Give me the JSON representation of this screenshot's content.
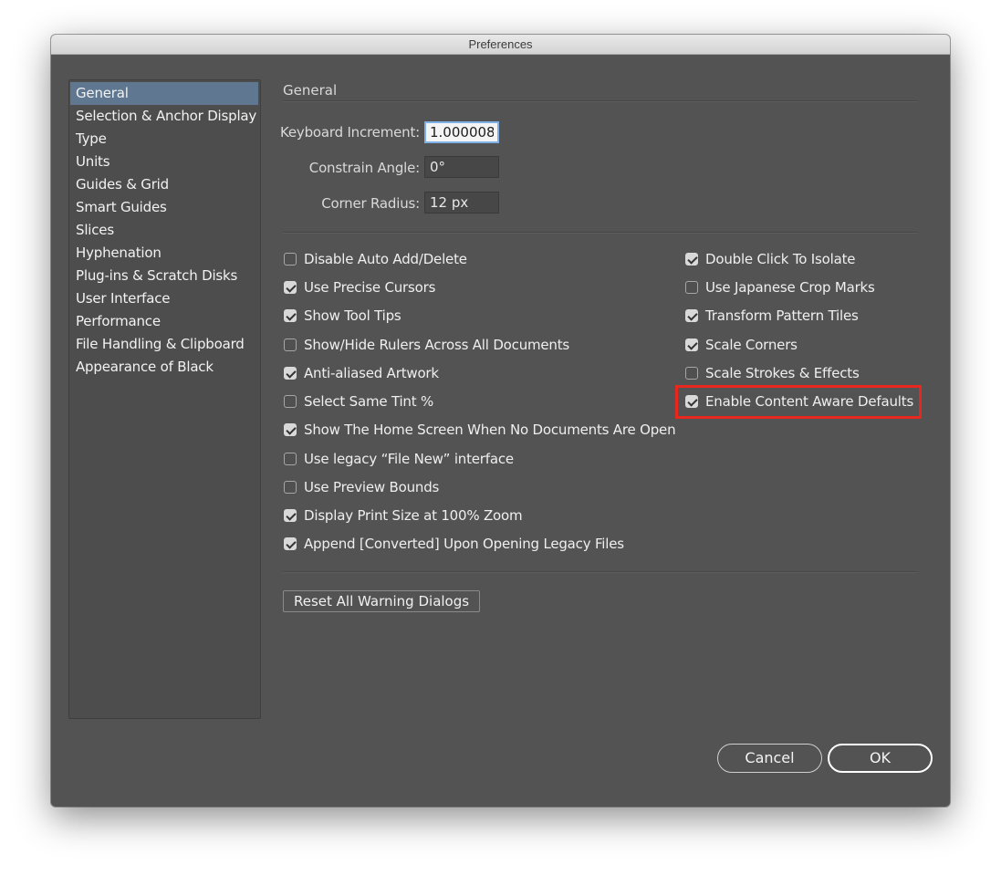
{
  "window": {
    "title": "Preferences"
  },
  "sidebar": {
    "items": [
      {
        "label": "General",
        "selected": true
      },
      {
        "label": "Selection & Anchor Display"
      },
      {
        "label": "Type"
      },
      {
        "label": "Units"
      },
      {
        "label": "Guides & Grid"
      },
      {
        "label": "Smart Guides"
      },
      {
        "label": "Slices"
      },
      {
        "label": "Hyphenation"
      },
      {
        "label": "Plug-ins & Scratch Disks"
      },
      {
        "label": "User Interface"
      },
      {
        "label": "Performance"
      },
      {
        "label": "File Handling & Clipboard"
      },
      {
        "label": "Appearance of Black"
      }
    ]
  },
  "main": {
    "section_title": "General",
    "fields": {
      "keyboard_increment": {
        "label": "Keyboard Increment:",
        "value": "1.000008 px"
      },
      "constrain_angle": {
        "label": "Constrain Angle:",
        "value": "0°"
      },
      "corner_radius": {
        "label": "Corner Radius:",
        "value": "12 px"
      }
    },
    "left_options": [
      {
        "label": "Disable Auto Add/Delete",
        "checked": false
      },
      {
        "label": "Use Precise Cursors",
        "checked": true
      },
      {
        "label": "Show Tool Tips",
        "checked": true
      },
      {
        "label": "Show/Hide Rulers Across All Documents",
        "checked": false
      },
      {
        "label": "Anti-aliased Artwork",
        "checked": true
      },
      {
        "label": "Select Same Tint %",
        "checked": false
      },
      {
        "label": "Show The Home Screen When No Documents Are Open",
        "checked": true
      },
      {
        "label": "Use legacy “File New” interface",
        "checked": false
      },
      {
        "label": "Use Preview Bounds",
        "checked": false
      },
      {
        "label": "Display Print Size at 100% Zoom",
        "checked": true
      },
      {
        "label": "Append [Converted] Upon Opening Legacy Files",
        "checked": true
      }
    ],
    "right_options": [
      {
        "label": "Double Click To Isolate",
        "checked": true
      },
      {
        "label": "Use Japanese Crop Marks",
        "checked": false
      },
      {
        "label": "Transform Pattern Tiles",
        "checked": true
      },
      {
        "label": "Scale Corners",
        "checked": true
      },
      {
        "label": "Scale Strokes & Effects",
        "checked": false
      },
      {
        "label": "Enable Content Aware Defaults",
        "checked": true
      }
    ],
    "reset_button": "Reset All Warning Dialogs"
  },
  "footer": {
    "cancel": "Cancel",
    "ok": "OK"
  },
  "colors": {
    "highlight": "#e8281f",
    "selection": "#5f7790",
    "background": "#535353"
  }
}
